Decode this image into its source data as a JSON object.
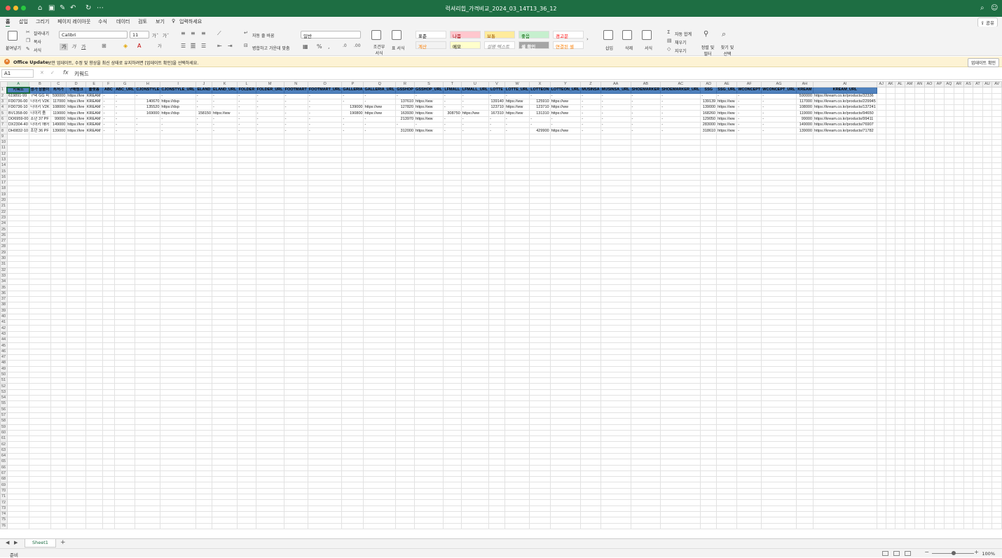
{
  "window": {
    "title": "럭셔리힙_가격비교_2024_03_14T13_36_12",
    "share_label": "공유"
  },
  "ribbon_tabs": [
    "홈",
    "삽입",
    "그리기",
    "페이지 레이아웃",
    "수식",
    "데이터",
    "검토",
    "보기"
  ],
  "tell_me": "입력하세요",
  "ribbon": {
    "paste": "붙여넣기",
    "cut": "잘라내기",
    "copy": "복사",
    "format_painter": "서식",
    "font_name": "Calibri",
    "font_size": "11",
    "bold": "가",
    "italic": "가",
    "underline": "가",
    "wrap_text": "자동 줄 바꿈",
    "merge_center": "병합하고 가운데 맞춤",
    "number_format": "일반",
    "conditional": "조건부 서식",
    "table_format": "표 서식",
    "styles": [
      {
        "label": "표준",
        "bg": "#ffffff",
        "fg": "#000000"
      },
      {
        "label": "나쁨",
        "bg": "#ffc7ce",
        "fg": "#9c0006"
      },
      {
        "label": "보통",
        "bg": "#ffeb9c",
        "fg": "#9c5700"
      },
      {
        "label": "좋음",
        "bg": "#c6efce",
        "fg": "#006100"
      },
      {
        "label": "경고문",
        "bg": "#ffffff",
        "fg": "#ff0000"
      },
      {
        "label": "계산",
        "bg": "#f2f2f2",
        "fg": "#fa7d00"
      },
      {
        "label": "메모",
        "bg": "#ffffcc",
        "fg": "#000000"
      },
      {
        "label": "설명 텍스트",
        "bg": "#ffffff",
        "fg": "#7f7f7f"
      },
      {
        "label": "셀 확인",
        "bg": "#a5a5a5",
        "fg": "#ffffff"
      },
      {
        "label": "연결된 셀",
        "bg": "#ffffff",
        "fg": "#fa7d00"
      }
    ],
    "insert": "삽입",
    "delete": "삭제",
    "format": "서식",
    "autosum": "자동 합계",
    "fill": "채우기",
    "clear": "지우기",
    "sort_filter": "정렬 및 필터",
    "find_select": "찾기 및 선택"
  },
  "update_bar": {
    "title": "Office Update",
    "message": "보안 업데이트, 수정 및 향상을 최신 상태로 유지하려면 [업데이트 확인]을 선택하세요.",
    "button": "업데이트 확인"
  },
  "formula_bar": {
    "name_box": "A1",
    "value": "키워드"
  },
  "columns": [
    "A",
    "B",
    "C",
    "D",
    "E",
    "F",
    "G",
    "H",
    "I",
    "J",
    "K",
    "L",
    "M",
    "N",
    "O",
    "P",
    "Q",
    "R",
    "S",
    "T",
    "U",
    "V",
    "W",
    "X",
    "Y",
    "Z",
    "AA",
    "AB",
    "AC",
    "AD",
    "AE",
    "AF",
    "AG",
    "AH",
    "AI",
    "AJ",
    "AK",
    "AL",
    "AM",
    "AN",
    "AO",
    "AP",
    "AQ",
    "AR",
    "AS",
    "AT",
    "AU",
    "AV"
  ],
  "header_row": [
    "키워드",
    "정가 상품이",
    "최저가",
    "구매링크",
    "플랫폼",
    "ABC",
    "ABC_URL",
    "CJONSTYLE",
    "CJONSTYLE_URL",
    "ELAND",
    "ELAND_URL",
    "FOLDER",
    "FOLDER_URL",
    "FOOTMART",
    "FOOTMART_URL",
    "GALLERIA",
    "GALLERIA_URL",
    "GSSHOP",
    "GSSHOP_URL",
    "LFMALL",
    "LFMALL_URL",
    "LOTTE",
    "LOTTE_URL",
    "LOTTEON",
    "LOTTEON_URL",
    "MUSINSA",
    "MUSINSA_URL",
    "SHOEMARKER",
    "SHOEMARKER_URL",
    "SSG",
    "SSG_URL",
    "WCONCEPT",
    "WCONCEPT_URL",
    "KREAM",
    "KREAM_URL"
  ],
  "rows": [
    [
      "619891-99",
      "구찌 GG 피",
      "590000",
      "https://kre",
      "KREAM",
      "-",
      "-",
      "-",
      "-",
      "-",
      "-",
      "-",
      "-",
      "-",
      "-",
      "-",
      "-",
      "-",
      "-",
      "-",
      "-",
      "-",
      "-",
      "-",
      "-",
      "-",
      "-",
      "-",
      "-",
      "-",
      "-",
      "-",
      "-",
      "590000",
      "https://kream.co.kr/products/32336"
    ],
    [
      "FD0736-00",
      "나이키 V2K",
      "117000",
      "https://kre",
      "KREAM",
      "-",
      "-",
      "140670",
      "https://dsp",
      "-",
      "-",
      "-",
      "-",
      "-",
      "-",
      "-",
      "-",
      "137610",
      "https://ww",
      "-",
      "-",
      "139140",
      "https://ww",
      "125910",
      "https://ww",
      "-",
      "-",
      "-",
      "-",
      "139139",
      "https://ww",
      "-",
      "-",
      "117000",
      "https://kream.co.kr/products/229945"
    ],
    [
      "FD0736-10",
      "나이키 V2K",
      "108000",
      "https://kre",
      "KREAM",
      "-",
      "-",
      "135520",
      "https://dsp",
      "-",
      "-",
      "-",
      "-",
      "-",
      "-",
      "139000",
      "https://ww",
      "127820",
      "https://ww",
      "-",
      "-",
      "123710",
      "https://ww",
      "123710",
      "https://ww",
      "-",
      "-",
      "-",
      "-",
      "139000",
      "https://ww",
      "-",
      "-",
      "108000",
      "https://kream.co.kr/products/137241"
    ],
    [
      "BV1358-00",
      "나이키 줌",
      "119000",
      "https://kre",
      "KREAM",
      "-",
      "-",
      "169000",
      "https://dsp",
      "158150",
      "https://ww",
      "-",
      "-",
      "-",
      "-",
      "190800",
      "https://ww",
      "163930",
      "https://ww",
      "308750",
      "https://ww",
      "167310",
      "https://ww",
      "131310",
      "https://ww",
      "-",
      "-",
      "-",
      "-",
      "168260",
      "https://ww",
      "-",
      "-",
      "119000",
      "https://kream.co.kr/products/94650"
    ],
    [
      "DO6959-00",
      "조던 37 PF",
      "99000",
      "https://kre",
      "KREAM",
      "-",
      "-",
      "-",
      "-",
      "-",
      "-",
      "-",
      "-",
      "-",
      "-",
      "-",
      "-",
      "213970",
      "https://ww",
      "-",
      "-",
      "-",
      "-",
      "-",
      "-",
      "-",
      "-",
      "-",
      "-",
      "129050",
      "https://ww",
      "-",
      "-",
      "99000",
      "https://kream.co.kr/products/99411"
    ],
    [
      "DX2304-40",
      "나이키 에어",
      "149000",
      "https://kre",
      "KREAM",
      "-",
      "-",
      "-",
      "-",
      "-",
      "-",
      "-",
      "-",
      "-",
      "-",
      "-",
      "-",
      "-",
      "-",
      "-",
      "-",
      "-",
      "-",
      "-",
      "-",
      "-",
      "-",
      "-",
      "-",
      "283000",
      "https://ww",
      "-",
      "-",
      "149000",
      "https://kream.co.kr/products/76907"
    ],
    [
      "DH0832-10",
      "조던 36 PF",
      "139000",
      "https://kre",
      "KREAM",
      "-",
      "-",
      "-",
      "-",
      "-",
      "-",
      "-",
      "-",
      "-",
      "-",
      "-",
      "-",
      "312000",
      "https://ww",
      "-",
      "-",
      "-",
      "-",
      "429900",
      "https://ww",
      "-",
      "-",
      "-",
      "-",
      "318610",
      "https://ww",
      "-",
      "-",
      "139000",
      "https://kream.co.kr/products/71782"
    ]
  ],
  "total_rows": 76,
  "sheet_tab": "Sheet1",
  "status": "준비",
  "zoom": "100%",
  "colors": {
    "title_bar": "#1e6e43",
    "header_fill": "#4f81bd",
    "selection": "#1e6e43"
  }
}
